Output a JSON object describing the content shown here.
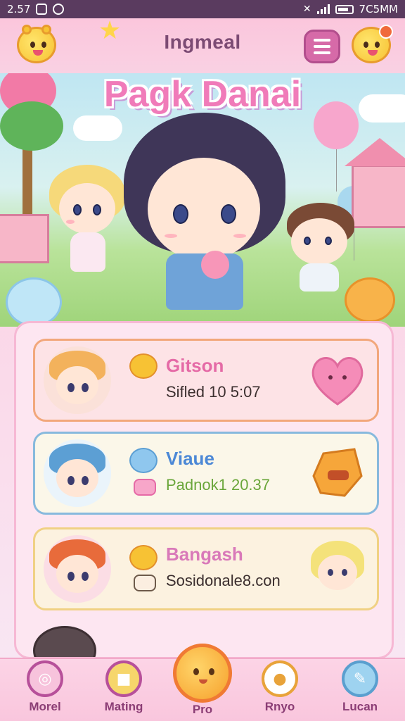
{
  "status_bar": {
    "time": "2.57",
    "right_text": "7C5MM",
    "icons": [
      "message-icon",
      "settings-icon",
      "mute-icon",
      "signal-icon",
      "battery-icon"
    ]
  },
  "header": {
    "title": "Ingmeal",
    "left_mascot": "smiling-mascot-icon",
    "right_mascot": "mascot-badge-icon",
    "menu_icon": "hamburger-menu-icon"
  },
  "hero": {
    "title": "Pagk Danai"
  },
  "cards": [
    {
      "name": "Gitson",
      "detail": "Sifled 10 5:07",
      "name_color": "#e56aa6",
      "border_color": "#f2a77b",
      "background": "#fde3e6",
      "badge_icon": "yellow-bear-icon",
      "side_icon": "pink-heart-icon"
    },
    {
      "name": "Viaue",
      "detail": "Padnok1 20.37",
      "name_color": "#4c88d6",
      "detail_color": "#6aa63a",
      "border_color": "#87b9dd",
      "background": "#fbf7e9",
      "badge_icon": "blue-flower-icon",
      "small_icon": "pink-heart-icon",
      "side_icon": "orange-cookie-icon"
    },
    {
      "name": "Bangash",
      "detail": "Sosidonale8.con",
      "name_color": "#d979b9",
      "border_color": "#f0d184",
      "background": "#fcf2e0",
      "badge_icon": "yellow-cat-icon",
      "small_icon": "briefcase-icon",
      "side_icon": "blonde-chibi-avatar"
    }
  ],
  "bottom_nav": [
    {
      "label": "Morel",
      "icon": "pink-circle-icon"
    },
    {
      "label": "Mating",
      "icon": "gift-icon"
    },
    {
      "label": "Pro",
      "icon": "center-mascot-icon"
    },
    {
      "label": "Rnyo",
      "icon": "bee-icon"
    },
    {
      "label": "Lucan",
      "icon": "pencil-icon"
    }
  ],
  "colors": {
    "status_bar": "#5a3b5f",
    "header": "#fbc6dc",
    "accent_pink": "#f07bb9",
    "nav_label": "#8b3d75"
  }
}
